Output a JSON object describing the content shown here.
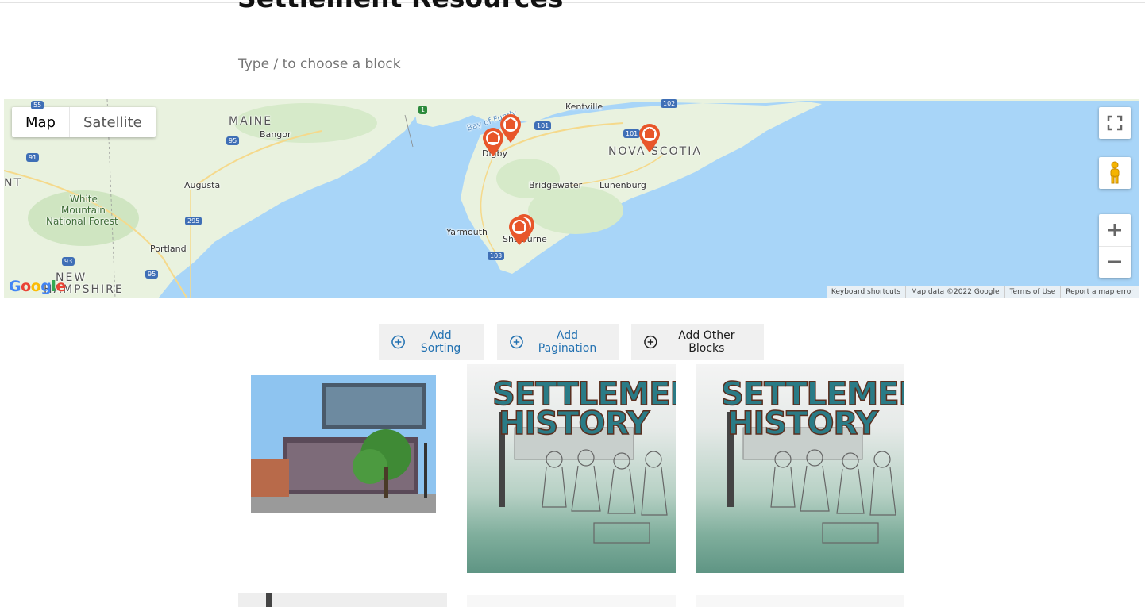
{
  "page": {
    "title": "Settlement Resources",
    "block_hint": "Type / to choose a block"
  },
  "map": {
    "type_controls": {
      "map_label": "Map",
      "satellite_label": "Satellite"
    },
    "labels": {
      "maine": "MAINE",
      "bangor": "Bangor",
      "augusta": "Augusta",
      "portland": "Portland",
      "white_mountain": "White",
      "white_mountain2": "Mountain",
      "white_mountain3": "National Forest",
      "new_hampshire": "NEW",
      "new_hampshire2": "HAMPSHIRE",
      "vermont_part": "NT",
      "nova_scotia": "NOVA SCOTIA",
      "kentville": "Kentville",
      "bay_of_fundy": "Bay of Fundy",
      "digby": "Digby",
      "bridgewater": "Bridgewater",
      "lunenburg": "Lunenburg",
      "yarmouth": "Yarmouth",
      "shelburne": "Shelburne"
    },
    "shields": [
      "55",
      "91",
      "95",
      "295",
      "93",
      "95",
      "1",
      "101",
      "101",
      "102",
      "103"
    ],
    "google_logo": "Google",
    "attribution": [
      "Keyboard shortcuts",
      "Map data ©2022 Google",
      "Terms of Use",
      "Report a map error"
    ],
    "accent_pin_color": "#e8562a"
  },
  "toolbar": {
    "add_sorting": "Add Sorting",
    "add_pagination": "Add Pagination",
    "add_other_blocks": "Add Other Blocks"
  },
  "tiles": [
    {
      "art_line1": "SETTLEMENT",
      "art_line2": "HISTORY"
    },
    {
      "art_line1": "SETTLEMENT",
      "art_line2": "HISTORY"
    }
  ],
  "colors": {
    "link_blue": "#2271b1",
    "water": "#a8d5f8",
    "land": "#e9f2df"
  }
}
